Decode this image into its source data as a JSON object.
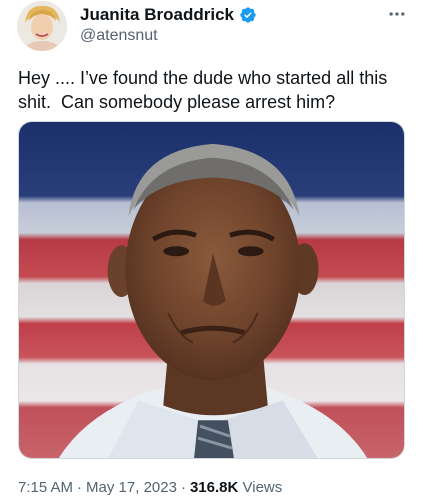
{
  "author": {
    "display_name": "Juanita Broaddrick",
    "handle": "@atensnut",
    "verified": true
  },
  "tweet": {
    "text": "Hey .... I’ve found the dude who started all this shit.  Can somebody please arrest him?"
  },
  "media": {
    "icon": "photo"
  },
  "meta": {
    "time": "7:15 AM",
    "separator": "·",
    "date": "May 17, 2023",
    "views_count": "316.8K",
    "views_label": "Views"
  },
  "colors": {
    "text": "#0f1419",
    "secondary": "#536471",
    "verified_blue": "#1d9bf0"
  },
  "icons": {
    "verified": "verified-badge-icon",
    "more": "more-dots-icon"
  }
}
